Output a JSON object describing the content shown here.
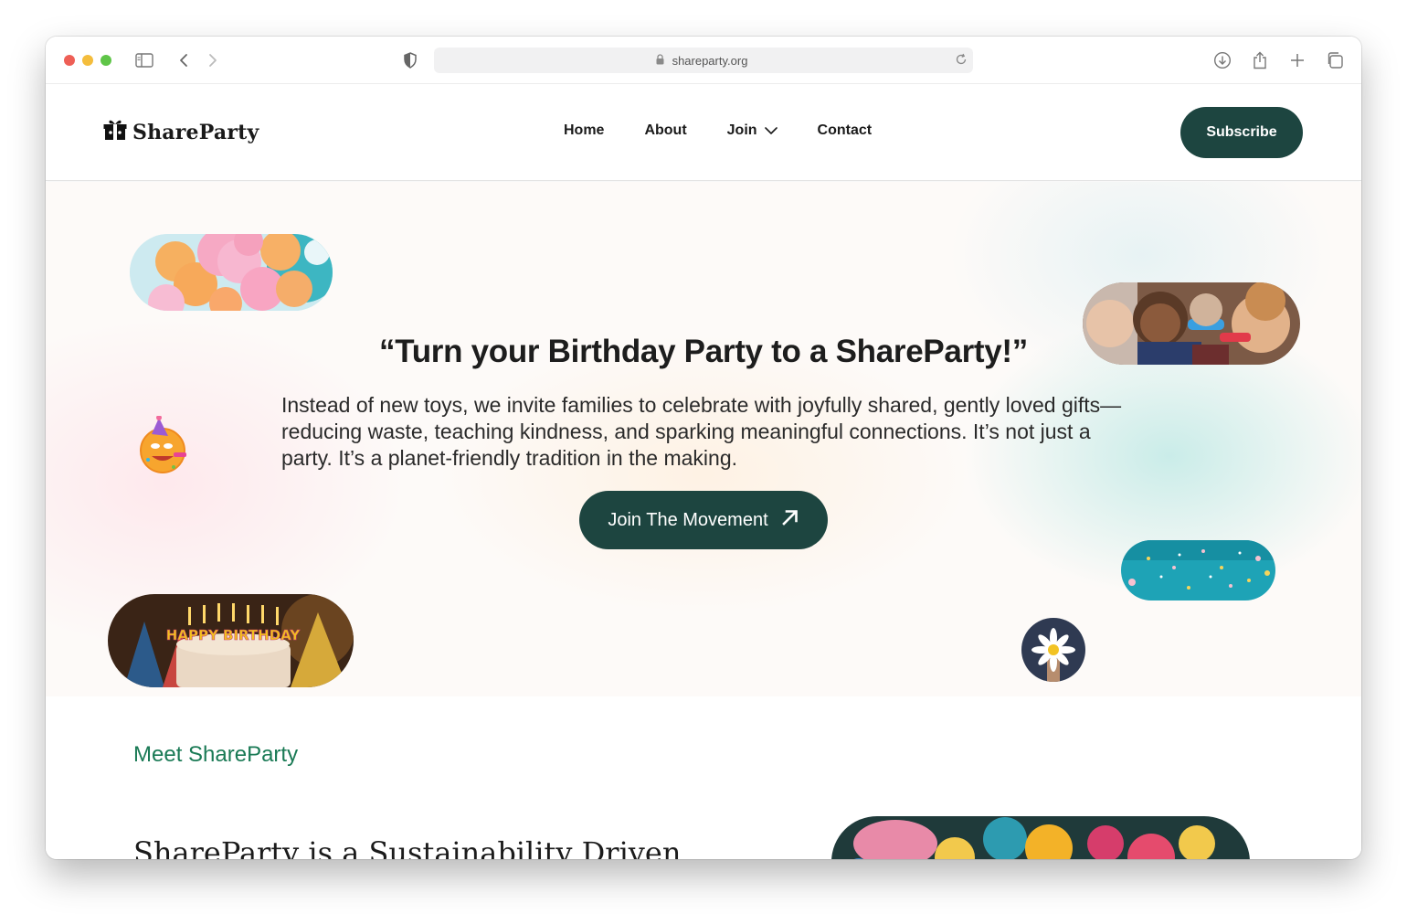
{
  "browser": {
    "url": "shareparty.org"
  },
  "header": {
    "logo_text": "ShareParty",
    "nav": [
      {
        "label": "Home"
      },
      {
        "label": "About"
      },
      {
        "label": "Join"
      },
      {
        "label": "Contact"
      }
    ],
    "subscribe_label": "Subscribe"
  },
  "hero": {
    "title": "“Turn your Birthday Party to a ShareParty!”",
    "description": "Instead of new toys, we invite families to celebrate with joyfully shared, gently loved gifts—reducing waste, teaching kindness, and sparking meaningful connections. It’s not just a party. It’s a planet-friendly tradition in the making.",
    "cta_label": "Join The Movement",
    "cake_text": "HAPPY BIRTHDAY"
  },
  "section": {
    "eyebrow": "Meet ShareParty",
    "title": "ShareParty is a Sustainability Driven"
  },
  "colors": {
    "brand_dark": "#1d4540",
    "accent_green": "#1a7a55"
  }
}
